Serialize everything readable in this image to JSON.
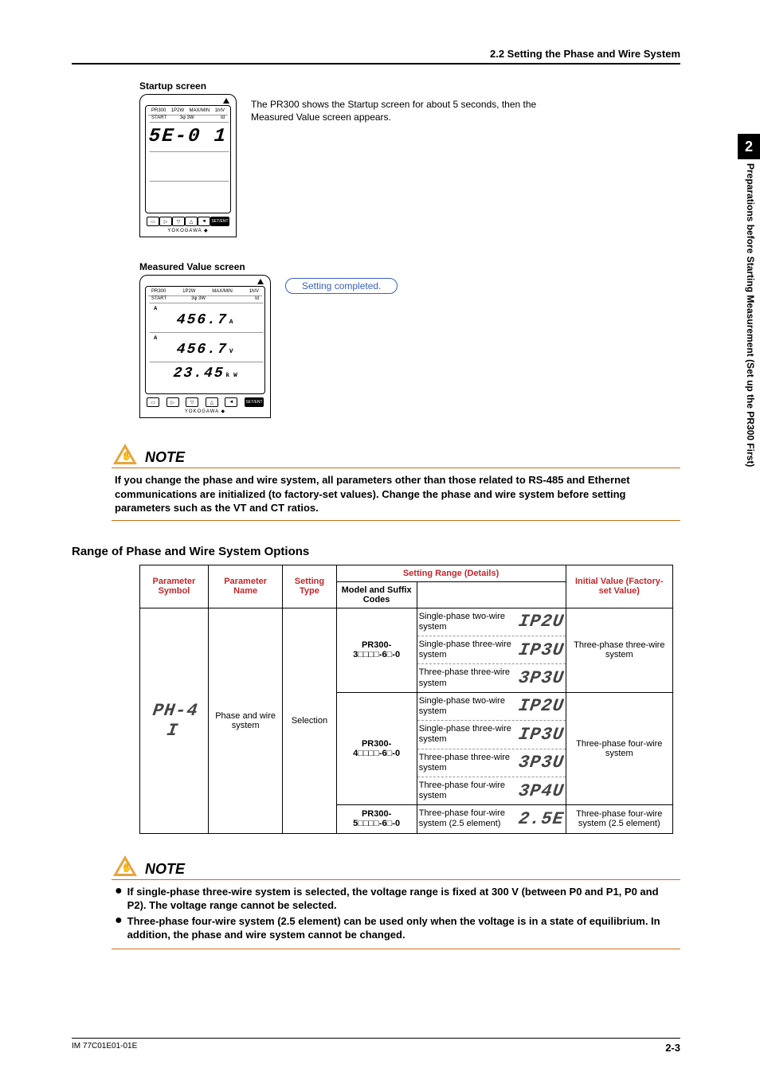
{
  "header": {
    "title": "2.2   Setting the Phase and Wire System"
  },
  "chapter": {
    "num": "2",
    "side": "Preparations before Starting Measurement (Set up the PR300 First)"
  },
  "startup": {
    "label": "Startup screen",
    "desc": "The PR300 shows the Startup screen for about 5 seconds, then the Measured Value screen appears.",
    "lcd": "5E-0 1",
    "brand": "YOKOGAWA ◆",
    "model": "PR300",
    "tags_left": "START",
    "tags_mid1": "1P2W",
    "tags_mid2": "3φ 3W",
    "tags_r1": "MAX/MIN",
    "tags_r2": "1hIV",
    "tags_r3": "Id"
  },
  "measured": {
    "label": "Measured Value screen",
    "badge": "Setting completed.",
    "row1_label": "A",
    "row1_val": "456.7",
    "row1_unit": "A",
    "row2_label": "A",
    "row2_val": "456.7",
    "row2_unit": "V",
    "row3_val": "23.45",
    "row3_unit": "k  W"
  },
  "note1": {
    "title": "NOTE",
    "body": "If you change the phase and wire system, all parameters other than those related to RS-485 and Ethernet communications are initialized (to factory-set values). Change the phase and wire system before setting parameters such as the VT and CT ratios."
  },
  "subhead": "Range of Phase and Wire System Options",
  "table": {
    "h_param_sym": "Parameter Symbol",
    "h_param_name": "Parameter Name",
    "h_setting_type": "Setting Type",
    "h_model": "Model and Suffix Codes",
    "h_range": "Setting Range (Details)",
    "h_init": "Initial Value (Factory-set Value)",
    "sym": "PH-4 I",
    "name": "Phase and wire system",
    "stype": "Selection",
    "m1": "PR300-3□□□□-6□-0",
    "m2": "PR300-4□□□□-6□-0",
    "m3": "PR300-5□□□□-6□-0",
    "r_1p2w": "Single-phase two-wire system",
    "r_1p3w": "Single-phase three-wire system",
    "r_3p3w": "Three-phase three-wire system",
    "r_3p4w": "Three-phase four-wire system",
    "r_25e": "Three-phase four-wire system (2.5 element)",
    "d_1p2w": "IP2U",
    "d_1p3w": "IP3U",
    "d_3p3w": "3P3U",
    "d_3p4w": "3P4U",
    "d_25e": "2.5E",
    "iv1": "Three-phase three-wire system",
    "iv2": "Three-phase four-wire system",
    "iv3": "Three-phase four-wire system (2.5 element)"
  },
  "note2": {
    "title": "NOTE",
    "b1": "If single-phase three-wire system is selected, the voltage range is fixed at 300 V (between P0 and P1, P0 and P2). The voltage range cannot be selected.",
    "b2": "Three-phase four-wire system (2.5 element) can be used only when the voltage is in a state of equilibrium. In addition, the phase and wire system cannot be changed."
  },
  "footer": {
    "left": "IM 77C01E01-01E",
    "right": "2-3"
  },
  "chart_data": {
    "type": "table",
    "columns": [
      "Parameter Symbol",
      "Parameter Name",
      "Setting Type",
      "Model and Suffix Codes",
      "Setting Range (Details)",
      "Display Code",
      "Initial Value (Factory-set Value)"
    ],
    "rows": [
      [
        "PH-4I",
        "Phase and wire system",
        "Selection",
        "PR300-3□□□□-6□-0",
        "Single-phase two-wire system",
        "1P2U",
        "Three-phase three-wire system"
      ],
      [
        "",
        "",
        "",
        "PR300-3□□□□-6□-0",
        "Single-phase three-wire system",
        "1P3U",
        "Three-phase three-wire system"
      ],
      [
        "",
        "",
        "",
        "PR300-3□□□□-6□-0",
        "Three-phase three-wire system",
        "3P3U",
        "Three-phase three-wire system"
      ],
      [
        "",
        "",
        "",
        "PR300-4□□□□-6□-0",
        "Single-phase two-wire system",
        "1P2U",
        "Three-phase four-wire system"
      ],
      [
        "",
        "",
        "",
        "PR300-4□□□□-6□-0",
        "Single-phase three-wire system",
        "1P3U",
        "Three-phase four-wire system"
      ],
      [
        "",
        "",
        "",
        "PR300-4□□□□-6□-0",
        "Three-phase three-wire system",
        "3P3U",
        "Three-phase four-wire system"
      ],
      [
        "",
        "",
        "",
        "PR300-4□□□□-6□-0",
        "Three-phase four-wire system",
        "3P4U",
        "Three-phase four-wire system"
      ],
      [
        "",
        "",
        "",
        "PR300-5□□□□-6□-0",
        "Three-phase four-wire system (2.5 element)",
        "2.5E",
        "Three-phase four-wire system (2.5 element)"
      ]
    ]
  }
}
